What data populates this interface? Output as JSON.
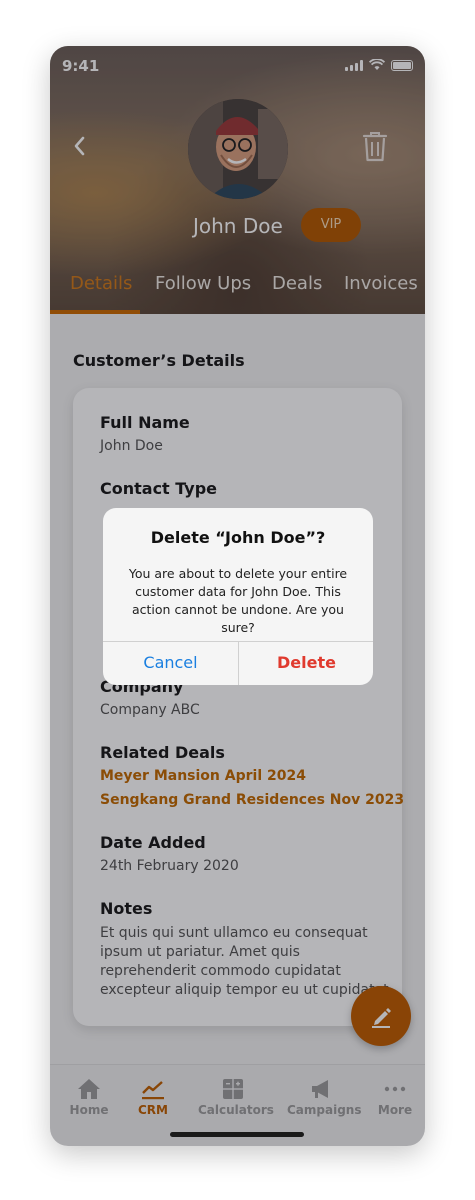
{
  "status_bar": {
    "time": "9:41"
  },
  "profile": {
    "name": "John Doe",
    "badge": "VIP"
  },
  "tabs": [
    {
      "label": "Details",
      "active": true
    },
    {
      "label": "Follow Ups",
      "active": false
    },
    {
      "label": "Deals",
      "active": false
    },
    {
      "label": "Invoices",
      "active": false
    }
  ],
  "section_title": "Customer’s Details",
  "fields": {
    "full_name": {
      "label": "Full Name",
      "value": "John Doe"
    },
    "contact_type": {
      "label": "Contact Type"
    },
    "company": {
      "label": "Company",
      "value": "Company ABC"
    },
    "related_deals": {
      "label": "Related Deals",
      "items": [
        "Meyer Mansion April 2024",
        "Sengkang Grand Residences Nov 2023"
      ]
    },
    "date_added": {
      "label": "Date Added",
      "value": "24th February 2020"
    },
    "notes": {
      "label": "Notes",
      "value": "Et quis qui sunt ullamco eu consequat ipsum ut pariatur. Amet quis reprehenderit commodo cupidatat excepteur aliquip tempor eu ut cupidatat"
    }
  },
  "bottom_nav": [
    {
      "label": "Home",
      "icon": "home-icon",
      "active": false
    },
    {
      "label": "CRM",
      "icon": "chart-line-icon",
      "active": true
    },
    {
      "label": "Calculators",
      "icon": "calculator-icon",
      "active": false
    },
    {
      "label": "Campaigns",
      "icon": "megaphone-icon",
      "active": false
    },
    {
      "label": "More",
      "icon": "more-dots-icon",
      "active": false
    }
  ],
  "dialog": {
    "title": "Delete “John Doe”?",
    "message": "You are about to delete your entire customer data for John Doe. This action cannot be undone. Are you sure?",
    "cancel_label": "Cancel",
    "delete_label": "Delete"
  },
  "colors": {
    "accent": "#c05d00",
    "destructive": "#e03a2e",
    "link_blue": "#1a7fe0"
  }
}
